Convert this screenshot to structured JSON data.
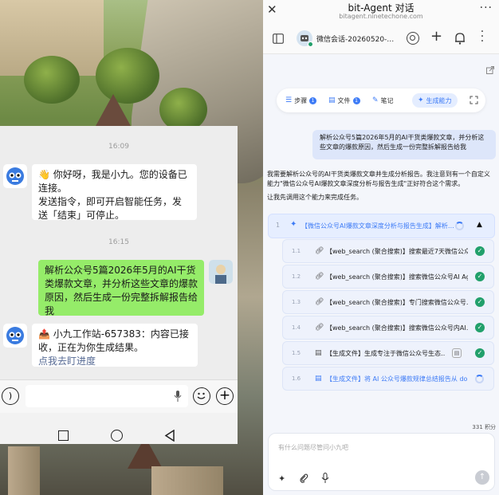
{
  "phone": {
    "timestamps": [
      "16:09",
      "16:15"
    ],
    "messages": [
      {
        "from": "bot",
        "line1": "👋 你好呀，我是小九。您的设备已连接。",
        "line2": "发送指令，即可开启智能任务，发送「结束」可停止。"
      },
      {
        "from": "user",
        "text": "解析公众号5篇2026年5月的AI干货类爆款文章，并分析这些文章的爆款原因，然后生成一份完整拆解报告给我"
      },
      {
        "from": "bot",
        "text": "📤 小九工作站-657383：内容已接收，正在为你生成结果。",
        "link": "点我去盯进度"
      }
    ]
  },
  "app": {
    "title": "bit-Agent 对话",
    "url": "bitagent.ninetechone.com",
    "session_title": "微信会话-20260520-…",
    "chips": [
      {
        "label": "步骤",
        "count": "1"
      },
      {
        "label": "文件",
        "count": "1"
      },
      {
        "label": "笔记",
        "count": ""
      },
      {
        "label": "生成能力",
        "count": ""
      }
    ],
    "user_message": "解析公众号5篇2026年5月的AI干货类爆款文章，并分析这些文章的爆款原因，然后生成一份完整拆解报告给我",
    "assistant_p1": "我需要解析公众号的AI干货类爆款文章并生成分析报告。我注意到有一个自定义能力\"微信公众号AI爆款文章深度分析与报告生成\"正好符合这个需求。",
    "assistant_p2": "让我先调用这个能力来完成任务。",
    "main_step": {
      "num": "1",
      "label": "【微信公众号AI爆款文章深度分析与报告生成】解析…"
    },
    "steps": [
      {
        "num": "1.1",
        "icon": "link-icon",
        "label": "【web_search (聚合搜索)】搜索最近7天微信公众…",
        "status": "done"
      },
      {
        "num": "1.2",
        "icon": "link-icon",
        "label": "【web_search (聚合搜索)】搜索微信公众号AI Ag…",
        "status": "done"
      },
      {
        "num": "1.3",
        "icon": "link-icon",
        "label": "【web_search (聚合搜索)】专门搜索微信公众号…",
        "status": "done"
      },
      {
        "num": "1.4",
        "icon": "link-icon",
        "label": "【web_search (聚合搜索)】搜索微信公众号内AI…",
        "status": "done"
      },
      {
        "num": "1.5",
        "icon": "file-icon",
        "label": "【生成文件】生成专注于微信公众号生态…",
        "status": "done"
      },
      {
        "num": "1.6",
        "icon": "file-icon",
        "label": "【生成文件】将 AI 公众号爆款规律总结报告从 do…",
        "status": "running"
      }
    ],
    "points": "331 积分",
    "input_placeholder": "有什么问题尽管问小九吧"
  },
  "colors": {
    "accent": "#3d7bf6",
    "wechat_green": "#95ec69",
    "done_green": "#22a06b"
  }
}
